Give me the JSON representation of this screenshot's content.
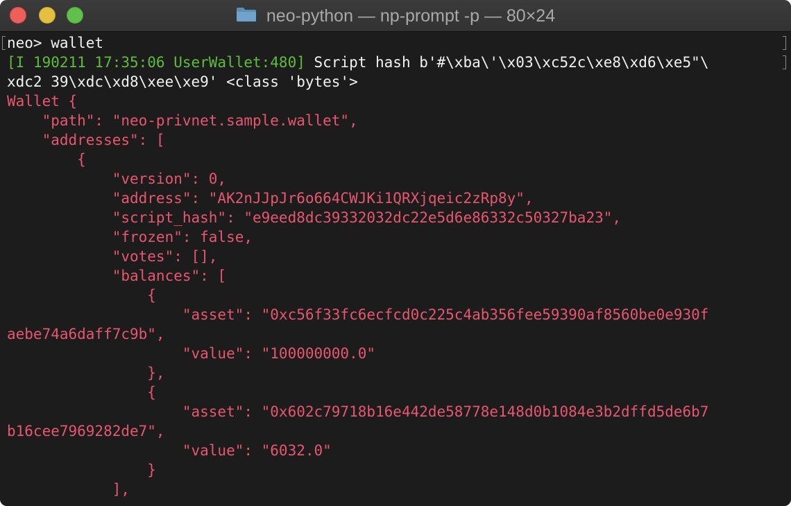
{
  "window": {
    "title": "neo-python — np-prompt -p — 80×24",
    "title_icon": "folder-icon"
  },
  "terminal": {
    "colors": {
      "background": "#1c1c1c",
      "log_prefix": "#5fbd3c",
      "output": "#e8566f",
      "text": "#f2f2f2"
    },
    "lines": [
      {
        "segments": [
          {
            "text": "neo> wallet",
            "cls": "white"
          }
        ]
      },
      {
        "segments": [
          {
            "text": "[I 190211 17:35:06 UserWallet:480]",
            "cls": "green"
          },
          {
            "text": " Script hash b'#\\xba\\'\\x03\\xc52c\\xe8\\xd6\\xe5\"\\",
            "cls": "white"
          }
        ]
      },
      {
        "segments": [
          {
            "text": "xdc2 39\\xdc\\xd8\\xee\\xe9' <class 'bytes'>",
            "cls": "white"
          }
        ]
      },
      {
        "segments": [
          {
            "text": "Wallet {",
            "cls": "pink"
          }
        ]
      },
      {
        "segments": [
          {
            "text": "    \"path\": \"neo-privnet.sample.wallet\",",
            "cls": "pink"
          }
        ]
      },
      {
        "segments": [
          {
            "text": "    \"addresses\": [",
            "cls": "pink"
          }
        ]
      },
      {
        "segments": [
          {
            "text": "        {",
            "cls": "pink"
          }
        ]
      },
      {
        "segments": [
          {
            "text": "            \"version\": 0,",
            "cls": "pink"
          }
        ]
      },
      {
        "segments": [
          {
            "text": "            \"address\": \"AK2nJJpJr6o664CWJKi1QRXjqeic2zRp8y\",",
            "cls": "pink"
          }
        ]
      },
      {
        "segments": [
          {
            "text": "            \"script_hash\": \"e9eed8dc39332032dc22e5d6e86332c50327ba23\",",
            "cls": "pink"
          }
        ]
      },
      {
        "segments": [
          {
            "text": "            \"frozen\": false,",
            "cls": "pink"
          }
        ]
      },
      {
        "segments": [
          {
            "text": "            \"votes\": [],",
            "cls": "pink"
          }
        ]
      },
      {
        "segments": [
          {
            "text": "            \"balances\": [",
            "cls": "pink"
          }
        ]
      },
      {
        "segments": [
          {
            "text": "                {",
            "cls": "pink"
          }
        ]
      },
      {
        "segments": [
          {
            "text": "                    \"asset\": \"0xc56f33fc6ecfcd0c225c4ab356fee59390af8560be0e930f",
            "cls": "pink"
          }
        ]
      },
      {
        "segments": [
          {
            "text": "aebe74a6daff7c9b\",",
            "cls": "pink"
          }
        ]
      },
      {
        "segments": [
          {
            "text": "                    \"value\": \"100000000.0\"",
            "cls": "pink"
          }
        ]
      },
      {
        "segments": [
          {
            "text": "                },",
            "cls": "pink"
          }
        ]
      },
      {
        "segments": [
          {
            "text": "                {",
            "cls": "pink"
          }
        ]
      },
      {
        "segments": [
          {
            "text": "                    \"asset\": \"0x602c79718b16e442de58778e148d0b1084e3b2dffd5de6b7",
            "cls": "pink"
          }
        ]
      },
      {
        "segments": [
          {
            "text": "b16cee7969282de7\",",
            "cls": "pink"
          }
        ]
      },
      {
        "segments": [
          {
            "text": "                    \"value\": \"6032.0\"",
            "cls": "pink"
          }
        ]
      },
      {
        "segments": [
          {
            "text": "                }",
            "cls": "pink"
          }
        ]
      },
      {
        "segments": [
          {
            "text": "            ],",
            "cls": "pink"
          }
        ]
      }
    ]
  }
}
